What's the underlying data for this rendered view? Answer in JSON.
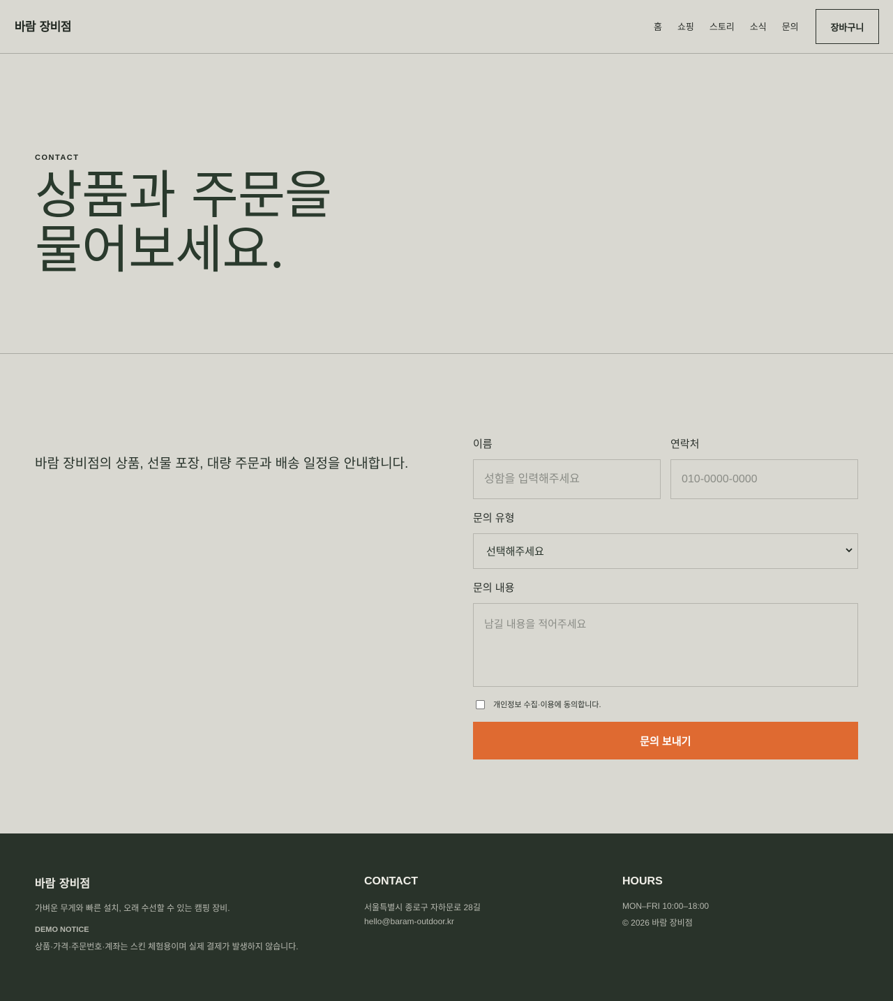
{
  "header": {
    "logo": "바람 장비점",
    "nav": [
      "홈",
      "쇼핑",
      "스토리",
      "소식",
      "문의"
    ],
    "cart_label": "장바구니"
  },
  "hero": {
    "eyebrow": "CONTACT",
    "title_line1": "상품과 주문을",
    "title_line2": "물어보세요."
  },
  "contact": {
    "intro": "바람 장비점의 상품, 선물 포장, 대량 주문과 배송 일정을 안내합니다.",
    "form": {
      "name_label": "이름",
      "name_placeholder": "성함을 입력해주세요",
      "phone_label": "연락처",
      "phone_placeholder": "010-0000-0000",
      "type_label": "문의 유형",
      "type_selected": "선택해주세요",
      "message_label": "문의 내용",
      "message_placeholder": "남길 내용을 적어주세요",
      "consent_label": "개인정보 수집·이용에 동의합니다.",
      "submit_label": "문의 보내기"
    }
  },
  "footer": {
    "brand": "바람 장비점",
    "tagline": "가벼운 무게와 빠른 설치, 오래 수선할 수 있는 캠핑 장비.",
    "notice_title": "DEMO NOTICE",
    "notice_text": "상품·가격·주문번호·계좌는 스킨 체험용이며 실제 결제가 발생하지 않습니다.",
    "contact_heading": "CONTACT",
    "address": "서울특별시 종로구 자하문로 28길",
    "email": "hello@baram-outdoor.kr",
    "hours_heading": "HOURS",
    "hours": "MON–FRI 10:00–18:00",
    "copyright": "© 2026 바람 장비점"
  },
  "colors": {
    "background": "#d9d8d1",
    "accent": "#df6a31",
    "footer_bg": "#29332a",
    "text": "#28332b"
  }
}
